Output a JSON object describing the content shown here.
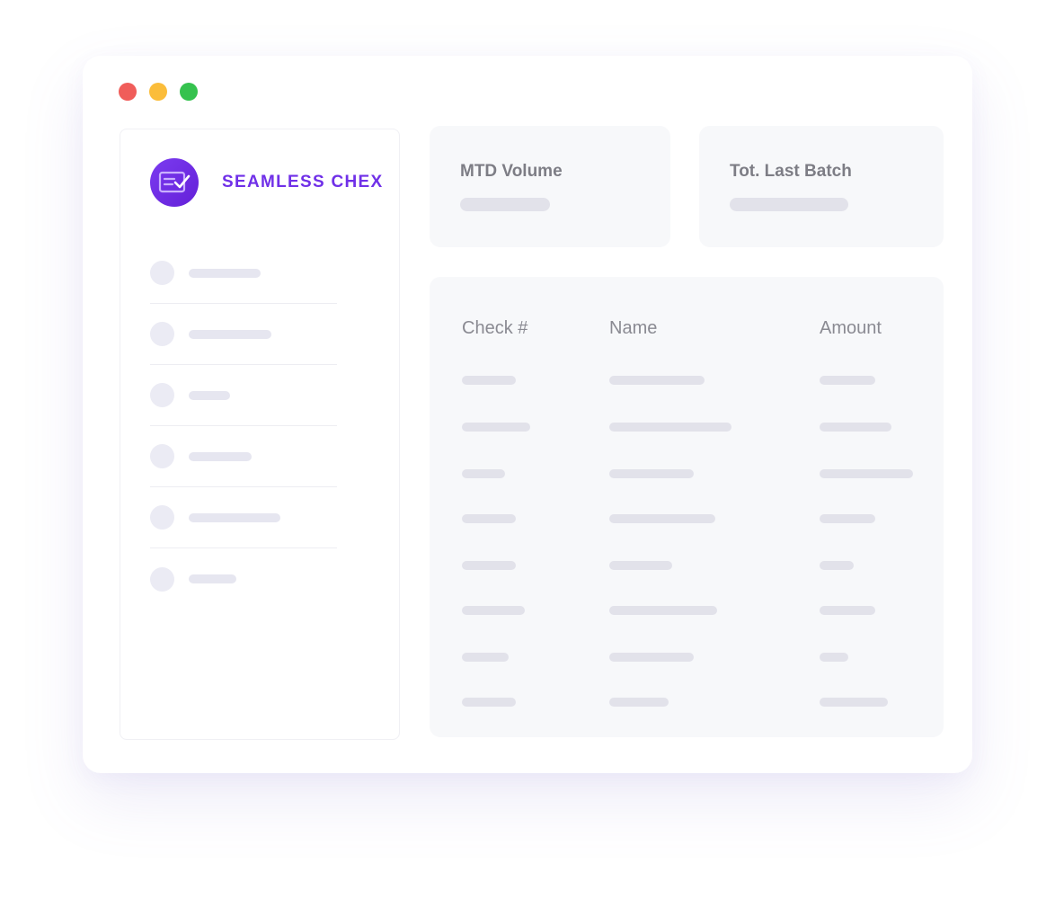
{
  "window": {
    "traffic_lights": [
      {
        "name": "close",
        "color": "#f05d5a"
      },
      {
        "name": "minimize",
        "color": "#fbbd3a"
      },
      {
        "name": "zoom",
        "color": "#35c24e"
      }
    ]
  },
  "sidebar": {
    "brand_name": "SEAMLESS CHEX",
    "logo_icon": "check-document-icon",
    "brand_color": "#7030e8",
    "items": [
      {
        "label": ""
      },
      {
        "label": ""
      },
      {
        "label": ""
      },
      {
        "label": ""
      },
      {
        "label": ""
      },
      {
        "label": ""
      }
    ]
  },
  "stats": {
    "mtd_volume_label": "MTD Volume",
    "mtd_volume_value": "",
    "last_batch_label": "Tot. Last Batch",
    "last_batch_value": ""
  },
  "table": {
    "columns": [
      "Check #",
      "Name",
      "Amount"
    ],
    "rows": [
      {
        "check": "",
        "name": "",
        "amount": ""
      },
      {
        "check": "",
        "name": "",
        "amount": ""
      },
      {
        "check": "",
        "name": "",
        "amount": ""
      },
      {
        "check": "",
        "name": "",
        "amount": ""
      },
      {
        "check": "",
        "name": "",
        "amount": ""
      },
      {
        "check": "",
        "name": "",
        "amount": ""
      },
      {
        "check": "",
        "name": "",
        "amount": ""
      },
      {
        "check": "",
        "name": "",
        "amount": ""
      }
    ]
  }
}
